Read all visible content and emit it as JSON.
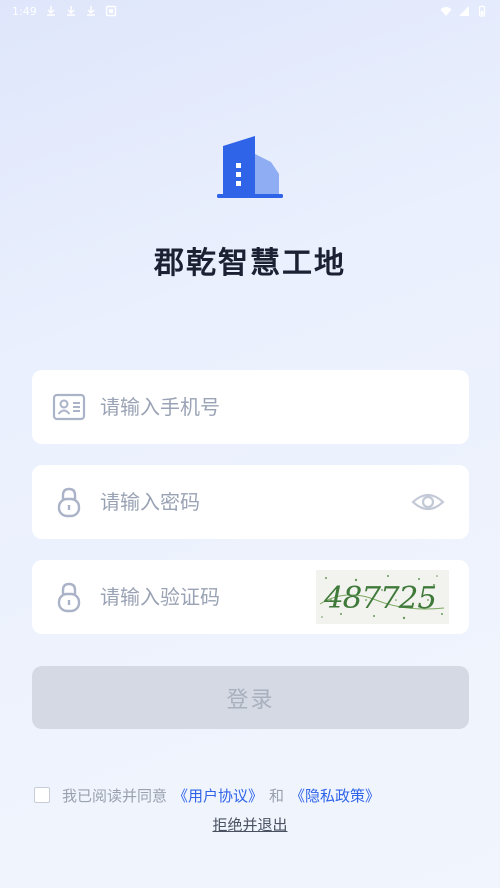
{
  "status_bar": {
    "time": "1:49"
  },
  "app": {
    "title": "郡乾智慧工地",
    "brand_color": "#2f64e8"
  },
  "form": {
    "phone_placeholder": "请输入手机号",
    "password_placeholder": "请输入密码",
    "captcha_placeholder": "请输入验证码",
    "captcha_text": "487725",
    "login_label": "登录"
  },
  "agreement": {
    "prefix": "我已阅读并同意",
    "user_agreement": "《用户协议》",
    "and": "和",
    "privacy_policy": "《隐私政策》",
    "exit_label": "拒绝并退出"
  }
}
